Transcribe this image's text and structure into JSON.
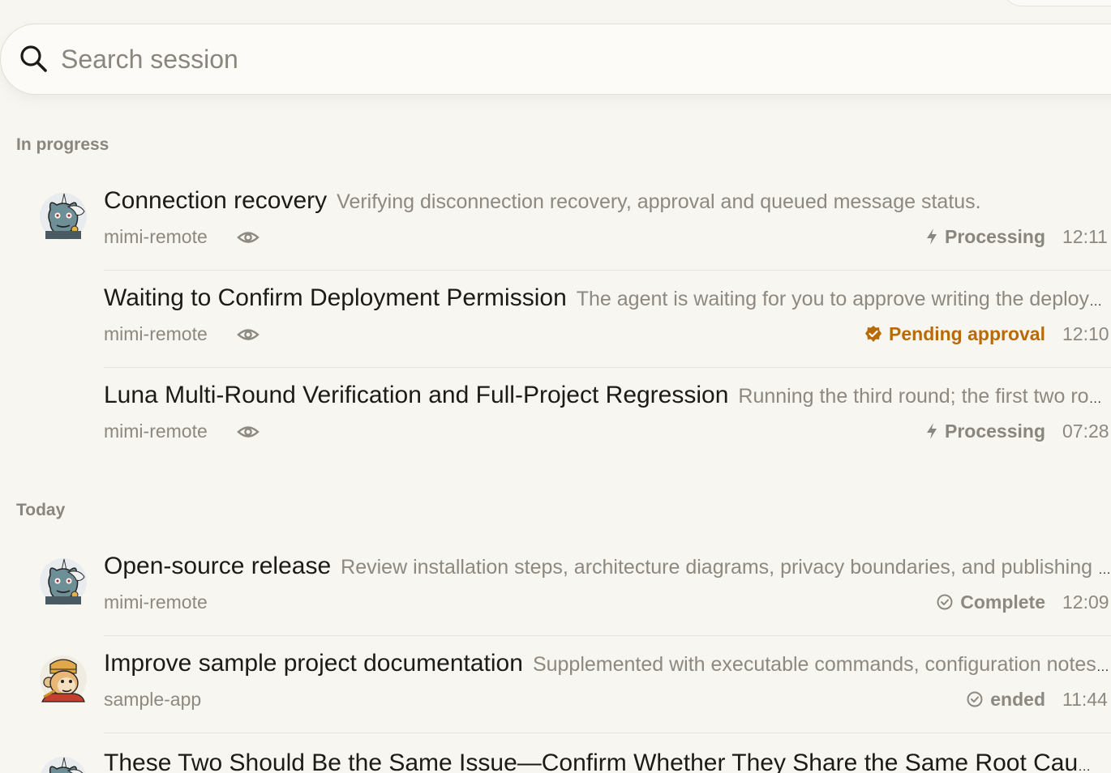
{
  "search": {
    "placeholder": "Search session"
  },
  "colors": {
    "pending": "#b86a07",
    "muted": "#8d8880",
    "processing": "#8a857d"
  },
  "sections": [
    {
      "title": "In progress",
      "rows": [
        {
          "title": "Connection recovery",
          "description": "Verifying disconnection recovery, approval and queued message status.",
          "project": "mimi-remote",
          "status": "Processing",
          "status_icon": "bolt-icon",
          "time": "12:11",
          "avatar": "unicorn-avatar",
          "watching": true
        },
        {
          "title": "Waiting to Confirm Deployment Permission",
          "description": "The agent is waiting for you to approve writing the deployment configuration",
          "project": "mimi-remote",
          "status": "Pending approval",
          "status_icon": "badge-check-icon",
          "time": "12:10",
          "avatar": "",
          "watching": true
        },
        {
          "title": "Luna Multi-Round Verification and Full-Project Regression",
          "description": "Running the third round; the first two rounds passed",
          "project": "mimi-remote",
          "status": "Processing",
          "status_icon": "bolt-icon",
          "time": "07:28",
          "avatar": "",
          "watching": true
        }
      ]
    },
    {
      "title": "Today",
      "rows": [
        {
          "title": "Open-source release",
          "description": "Review installation steps, architecture diagrams, privacy boundaries, and publishing checklist",
          "project": "mimi-remote",
          "status": "Complete",
          "status_icon": "check-circle-icon",
          "time": "12:09",
          "avatar": "unicorn-avatar",
          "watching": false
        },
        {
          "title": "Improve sample project documentation",
          "description": "Supplemented with executable commands, configuration notes and examples",
          "project": "sample-app",
          "status": "ended",
          "status_icon": "check-circle-icon",
          "time": "11:44",
          "avatar": "monkey-avatar",
          "watching": false
        },
        {
          "title": "These Two Should Be the Same Issue—Confirm Whether They Share the Same Root Cause",
          "description": "",
          "project": "",
          "status": "",
          "status_icon": "",
          "time": "",
          "avatar": "unicorn-avatar",
          "watching": false
        }
      ]
    }
  ]
}
